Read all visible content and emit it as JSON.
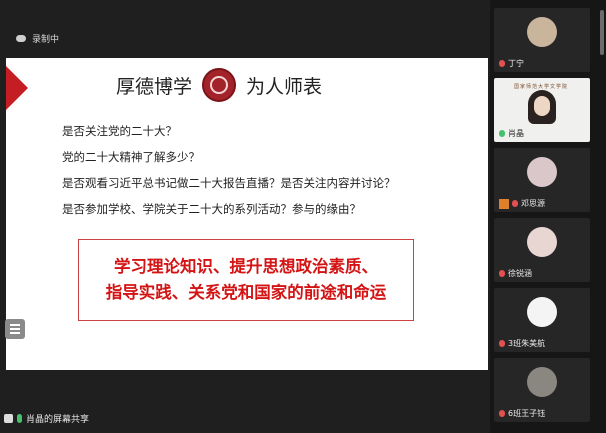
{
  "recording": {
    "label": "录制中"
  },
  "slide": {
    "motto_left": "厚德博学",
    "motto_right": "为人师表",
    "questions": [
      "是否关注党的二十大？",
      "党的二十大精神了解多少？",
      "是否观看习近平总书记做二十大报告直播？是否关注内容并讨论？",
      "是否参加学校、学院关于二十大的系列活动？参与的缘由？"
    ],
    "highlight": [
      "学习理论知识、提升思想政治素质、",
      "指导实践、关系党和国家的前途和命运"
    ]
  },
  "share_bar": {
    "label": "肖晶的屏幕共享"
  },
  "participants": [
    {
      "name": "丁宁",
      "avatar_color": "#c9b59c",
      "mic": "off"
    },
    {
      "name": "肖晶",
      "banner": "国家师范大学文学院",
      "mic": "on",
      "video": true
    },
    {
      "name": "邓思源",
      "avatar_color": "#d9c7c9",
      "mic": "off",
      "user_icon": true
    },
    {
      "name": "徐锐涵",
      "avatar_color": "#e8d6d2",
      "mic": "off"
    },
    {
      "name": "3班朱美航",
      "avatar_color": "#f4f4f4",
      "mic": "off"
    },
    {
      "name": "6班王子钰",
      "avatar_color": "#8a8680",
      "mic": "off"
    }
  ],
  "colors": {
    "accent_red": "#d41414",
    "flag_red": "#c41e24",
    "emblem": "#a3232a"
  }
}
